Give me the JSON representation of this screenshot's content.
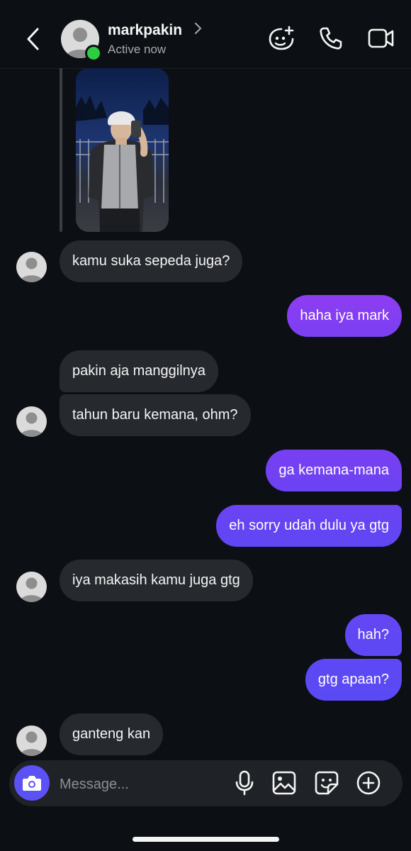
{
  "header": {
    "username": "markpakin",
    "status": "Active now",
    "icons": [
      "back-arrow-icon",
      "chevron-right-icon",
      "add-effect-icon",
      "phone-icon",
      "video-camera-icon"
    ]
  },
  "messages": [
    {
      "side": "in",
      "text": "kamu suka sepeda juga?"
    },
    {
      "side": "out",
      "text": "haha iya mark"
    },
    {
      "side": "in",
      "text": "pakin aja manggilnya"
    },
    {
      "side": "in",
      "text": "tahun baru kemana, ohm?"
    },
    {
      "side": "out",
      "text": "ga kemana-mana"
    },
    {
      "side": "out",
      "text": "eh sorry udah dulu ya gtg"
    },
    {
      "side": "in",
      "text": "iya makasih kamu juga gtg"
    },
    {
      "side": "out",
      "text": "hah?"
    },
    {
      "side": "out",
      "text": "gtg apaan?"
    },
    {
      "side": "in",
      "text": "ganteng kan"
    }
  ],
  "composer": {
    "placeholder": "Message...",
    "icons": [
      "camera-icon",
      "microphone-icon",
      "gallery-icon",
      "sticker-icon",
      "plus-icon"
    ]
  },
  "colors": {
    "background": "#0c1014",
    "incoming_bubble": "#262a2f",
    "outgoing_gradient_top": "#8b3df2",
    "outgoing_gradient_bottom": "#5b4cf5",
    "camera_button": "#5b51f5",
    "online_dot": "#2ecc40"
  }
}
